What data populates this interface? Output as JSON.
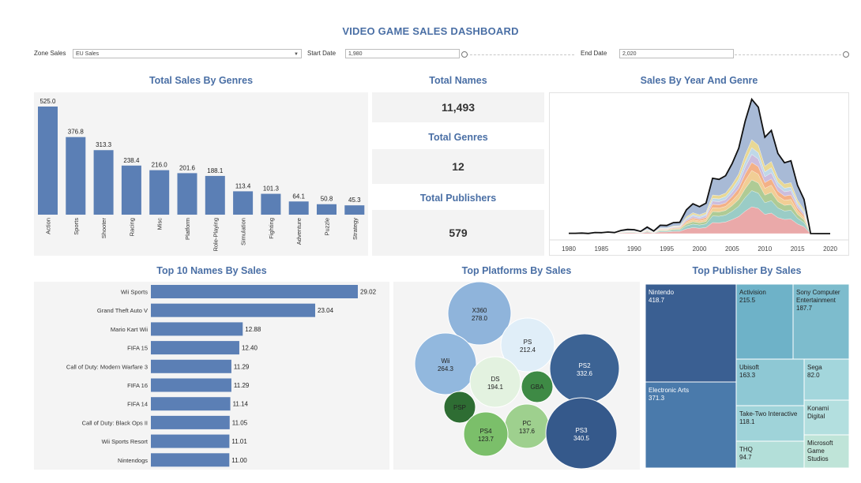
{
  "dashboard": {
    "title": "VIDEO GAME SALES DASHBOARD",
    "zone_label": "Zone Sales",
    "zone_value": "EU Sales",
    "start_label": "Start Date",
    "start_value": "1,980",
    "end_label": "End Date",
    "end_value": "2,020"
  },
  "titles": {
    "genres": "Total Sales By Genres",
    "names": "Total Names",
    "genres_total": "Total Genres",
    "publishers_total": "Total Publishers",
    "year_genre": "Sales By Year And Genre",
    "top_names": "Top 10 Names By Sales",
    "platforms": "Top Platforms By Sales",
    "publishers": "Top Publisher By Sales"
  },
  "kpis": {
    "total_names": "11,493",
    "total_genres": "12",
    "total_publishers": "579"
  },
  "colors": {
    "bar": "#5b7fb5",
    "title": "#4a6fa5"
  },
  "chart_data": [
    {
      "type": "bar",
      "id": "genres",
      "categories": [
        "Action",
        "Sports",
        "Shooter",
        "Racing",
        "Misc",
        "Platform",
        "Role-Playing",
        "Simulation",
        "Fighting",
        "Adventure",
        "Puzzle",
        "Strategy"
      ],
      "values": [
        525.0,
        376.8,
        313.3,
        238.4,
        216.0,
        201.6,
        188.1,
        113.4,
        101.3,
        64.1,
        50.8,
        45.3
      ],
      "labels": [
        "525.0",
        "376.8",
        "313.3",
        "238.4",
        "216.0",
        "201.6",
        "188.1",
        "113.4",
        "101.3",
        "64.1",
        "50.8",
        "45.3"
      ]
    },
    {
      "type": "area",
      "id": "year_genre",
      "x_ticks": [
        "1980",
        "1985",
        "1990",
        "1995",
        "2000",
        "2005",
        "2010",
        "2015",
        "2020"
      ],
      "years": [
        1980,
        1981,
        1982,
        1983,
        1984,
        1985,
        1986,
        1987,
        1988,
        1989,
        1990,
        1991,
        1992,
        1993,
        1994,
        1995,
        1996,
        1997,
        1998,
        1999,
        2000,
        2001,
        2002,
        2003,
        2004,
        2005,
        2006,
        2007,
        2008,
        2009,
        2010,
        2011,
        2012,
        2013,
        2014,
        2015,
        2016,
        2017,
        2018,
        2019,
        2020
      ],
      "totals": [
        0.5,
        0.6,
        1.0,
        0.3,
        2.0,
        1.7,
        2.8,
        1.9,
        5.6,
        7.5,
        7.1,
        3.9,
        11.7,
        4.7,
        14.9,
        14.6,
        19.6,
        20.4,
        42.7,
        53.4,
        48.2,
        54.5,
        98.9,
        97.0,
        103.6,
        125.4,
        152.7,
        201.3,
        240.3,
        226.1,
        172.4,
        184.5,
        143.4,
        126.8,
        130.2,
        86.5,
        61.2,
        0.2,
        0.0,
        0.0,
        0.0
      ],
      "layer_colors": [
        "#e8a0a0",
        "#8fc7c0",
        "#a6c58a",
        "#f0c98a",
        "#f2a97a",
        "#c7b6d9",
        "#b8d4e6",
        "#e6d48a",
        "#9fb3d1"
      ],
      "layer_shares": [
        0.2,
        0.12,
        0.08,
        0.07,
        0.06,
        0.06,
        0.05,
        0.06,
        0.3
      ]
    },
    {
      "type": "bar",
      "id": "top_names",
      "orientation": "horizontal",
      "categories": [
        "Wii Sports",
        "Grand Theft Auto V",
        "Mario Kart Wii",
        "FIFA 15",
        "Call of Duty: Modern Warfare 3",
        "FIFA 16",
        "FIFA 14",
        "Call of Duty: Black Ops II",
        "Wii Sports Resort",
        "Nintendogs"
      ],
      "values": [
        29.02,
        23.04,
        12.88,
        12.4,
        11.29,
        11.29,
        11.14,
        11.05,
        11.01,
        11.0
      ],
      "labels": [
        "29.02",
        "23.04",
        "12.88",
        "12.40",
        "11.29",
        "11.29",
        "11.14",
        "11.05",
        "11.01",
        "11.00"
      ]
    },
    {
      "type": "bubble",
      "id": "platforms",
      "bubbles": [
        {
          "name": "X360",
          "value": 278.0,
          "label": "278.0",
          "color": "#8fb4db",
          "text": "#222"
        },
        {
          "name": "PS",
          "value": 212.4,
          "label": "212.4",
          "color": "#e0eef8",
          "text": "#222"
        },
        {
          "name": "Wii",
          "value": 264.3,
          "label": "264.3",
          "color": "#92b8de",
          "text": "#222"
        },
        {
          "name": "PS2",
          "value": 332.6,
          "label": "332.6",
          "color": "#3c6394",
          "text": "#ffffff"
        },
        {
          "name": "DS",
          "value": 194.1,
          "label": "194.1",
          "color": "#e3f2e0",
          "text": "#222"
        },
        {
          "name": "GBA",
          "value": null,
          "label": "",
          "color": "#3e8a45",
          "text": "#222"
        },
        {
          "name": "PSP",
          "value": null,
          "label": "",
          "color": "#2e6d33",
          "text": "#222"
        },
        {
          "name": "PC",
          "value": 137.6,
          "label": "137.6",
          "color": "#9ed08e",
          "text": "#222"
        },
        {
          "name": "PS4",
          "value": 123.7,
          "label": "123.7",
          "color": "#7bbf6a",
          "text": "#222"
        },
        {
          "name": "PS3",
          "value": 340.5,
          "label": "340.5",
          "color": "#35598b",
          "text": "#ffffff"
        }
      ]
    },
    {
      "type": "treemap",
      "id": "publishers",
      "cells": [
        {
          "name": "Nintendo",
          "value": "418.7",
          "color": "#3a5f92",
          "text": "#ffffff"
        },
        {
          "name": "Electronic Arts",
          "value": "371.3",
          "color": "#4a7aab",
          "text": "#ffffff"
        },
        {
          "name": "Activision",
          "value": "215.5",
          "color": "#6eb2c8",
          "text": "#222"
        },
        {
          "name": "Sony Computer Entertainment",
          "value": "187.7",
          "color": "#7dbccd",
          "text": "#222"
        },
        {
          "name": "Ubisoft",
          "value": "163.3",
          "color": "#8ec8d4",
          "text": "#222"
        },
        {
          "name": "Sega",
          "value": "82.0",
          "color": "#a3d6dc",
          "text": "#222"
        },
        {
          "name": "Konami Digital",
          "value": "",
          "color": "#b3dfdf",
          "text": "#222"
        },
        {
          "name": "Take-Two Interactive",
          "value": "118.1",
          "color": "#9fd3d9",
          "text": "#222"
        },
        {
          "name": "THQ",
          "value": "94.7",
          "color": "#b3dfd9",
          "text": "#222"
        },
        {
          "name": "Microsoft Game Studios",
          "value": "",
          "color": "#bfe4d8",
          "text": "#222"
        }
      ]
    }
  ]
}
